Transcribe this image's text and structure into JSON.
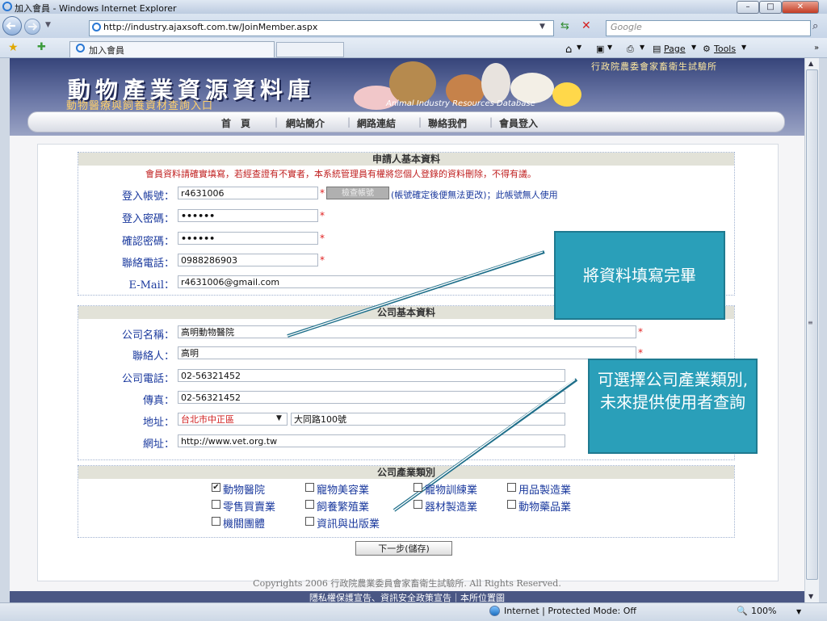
{
  "window": {
    "title": "加入會員 - Windows Internet Explorer"
  },
  "browser": {
    "url": "http://industry.ajaxsoft.com.tw/JoinMember.aspx",
    "search_placeholder": "Google",
    "tab_label": "加入會員",
    "page_menu": "Page",
    "tools_menu": "Tools",
    "status_zone": "Internet | Protected Mode: Off",
    "zoom": "100%"
  },
  "site": {
    "org_name": "行政院農委會家畜衛生試驗所",
    "title": "動物產業資源資料庫",
    "subtitle": "動物醫療與飼養資材查詢入口",
    "english_name": "Animal Industry Resources Database",
    "nav": [
      "首　頁",
      "網站簡介",
      "網路連結",
      "聯絡我們",
      "會員登入"
    ]
  },
  "applicant": {
    "heading": "申請人基本資料",
    "notice": "會員資料請確實填寫，若經查證有不實者，本系統管理員有權將您個人登錄的資料刪除，不得有議。",
    "account_label": "登入帳號：",
    "account_value": "r4631006",
    "check_button": "檢查帳號",
    "account_hint": "(帳號確定後便無法更改)；此帳號無人使用",
    "password_label": "登入密碼：",
    "password_value": "••••••",
    "confirm_label": "確認密碼：",
    "confirm_value": "••••••",
    "phone_label": "聯絡電話：",
    "phone_value": "0988286903",
    "email_label": "E-Mail：",
    "email_value": "r4631006@gmail.com",
    "required_mark": "*"
  },
  "company": {
    "heading": "公司基本資料",
    "name_label": "公司名稱：",
    "name_value": "高明動物醫院",
    "contact_label": "聯絡人：",
    "contact_value": "高明",
    "phone_label": "公司電話：",
    "phone_value": "02-56321452",
    "fax_label": "傳真：",
    "fax_value": "02-56321452",
    "address_label": "地址：",
    "address_district": "台北市中正區",
    "address_street": "大同路100號",
    "website_label": "網址：",
    "website_value": "http://www.vet.org.tw"
  },
  "industry": {
    "heading": "公司產業類別",
    "options": [
      "動物醫院",
      "寵物美容業",
      "寵物訓練業",
      "用品製造業",
      "零售買賣業",
      "飼養繁殖業",
      "器材製造業",
      "動物藥品業",
      "機關團體",
      "資訊與出版業"
    ],
    "checked": [
      true,
      false,
      false,
      false,
      false,
      false,
      false,
      false,
      false,
      false
    ]
  },
  "next_button": "下一步(儲存)",
  "footer": {
    "copyright": "Copyrights 2006 行政院農業委員會家畜衛生試驗所. All Rights Reserved.",
    "links": "隱私權保護宣告、資訊安全政策宣告｜本所位置圖"
  },
  "annotations": {
    "callout_1": "將資料填寫完畢",
    "callout_2": "可選擇公司產業類別,未來提供使用者查詢"
  }
}
